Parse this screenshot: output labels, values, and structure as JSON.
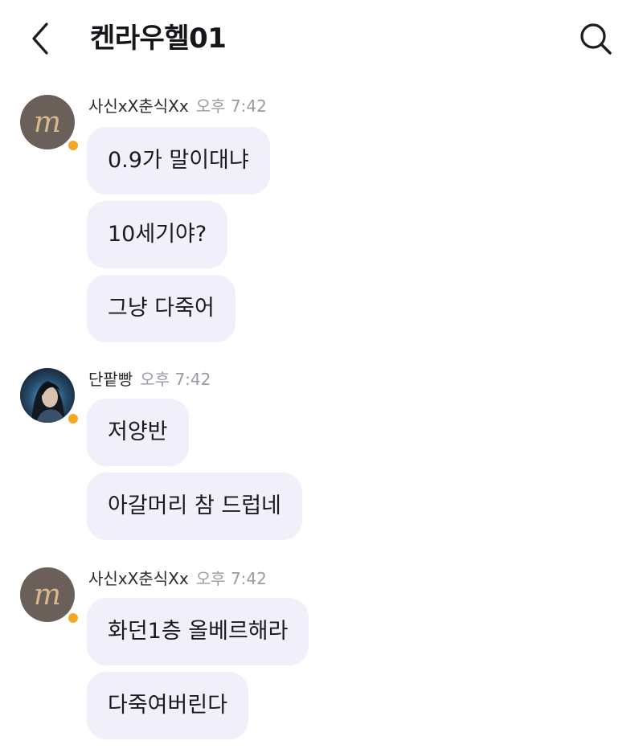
{
  "header": {
    "title": "켄라우헬01",
    "back_icon": "chevron-left-icon",
    "search_icon": "search-icon"
  },
  "groups": [
    {
      "sender": "사신xX춘식Xx",
      "time": "오후 7:42",
      "avatar": "monogram-m-avatar",
      "messages": [
        "0.9가 말이대냐",
        "10세기야?",
        "그냥 다죽어"
      ]
    },
    {
      "sender": "단팥빵",
      "time": "오후 7:42",
      "avatar": "character-portrait-avatar",
      "messages": [
        "저양반",
        "아갈머리 참 드럽네"
      ]
    },
    {
      "sender": "사신xX춘식Xx",
      "time": "오후 7:42",
      "avatar": "monogram-m-avatar",
      "messages": [
        "화던1층 올베르해라",
        "다죽여버린다"
      ]
    }
  ],
  "colors": {
    "bubble": "#f1f0fa",
    "status_dot": "#f5a623",
    "time_text": "#9a9aa2",
    "avatar_monogram_bg": "#6b5f59",
    "avatar_monogram_fg": "#d8b98c"
  }
}
